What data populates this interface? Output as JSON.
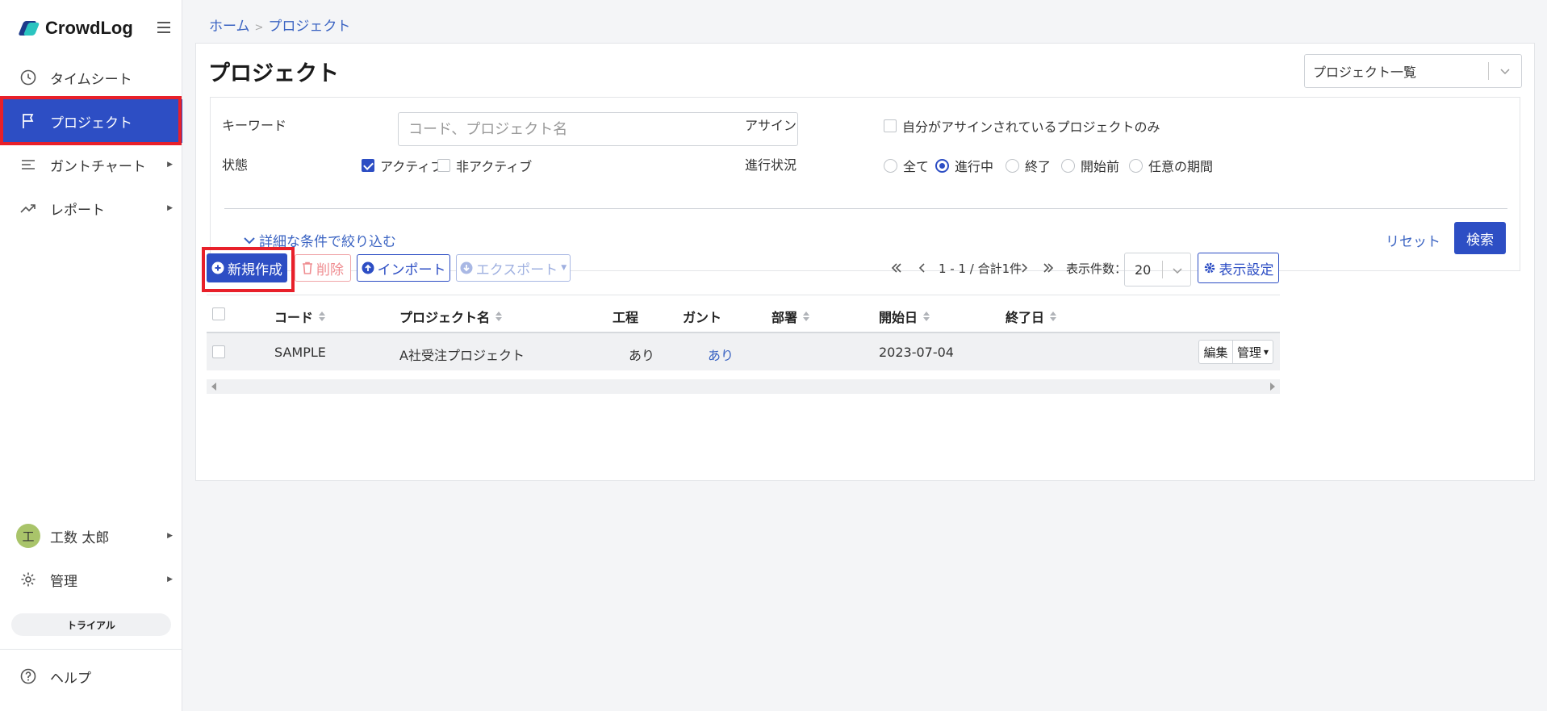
{
  "app": {
    "logo_text": "CrowdLog"
  },
  "sidebar": {
    "items": [
      {
        "label": "タイムシート",
        "icon": "clock-icon"
      },
      {
        "label": "プロジェクト",
        "icon": "flag-icon",
        "active": true
      },
      {
        "label": "ガントチャート",
        "icon": "gantt-icon",
        "has_submenu": true
      },
      {
        "label": "レポート",
        "icon": "trend-icon",
        "has_submenu": true
      }
    ],
    "user": {
      "avatar_initial": "工",
      "name": "工数 太郎"
    },
    "admin_label": "管理",
    "trial_label": "トライアル",
    "help_label": "ヘルプ"
  },
  "breadcrumb": {
    "home": "ホーム",
    "separator": ">",
    "current": "プロジェクト"
  },
  "page": {
    "title": "プロジェクト",
    "view_select": "プロジェクト一覧"
  },
  "filter": {
    "keyword_label": "キーワード",
    "keyword_placeholder": "コード、プロジェクト名",
    "keyword_value": "",
    "assign_label": "アサイン",
    "assign_option": "自分がアサインされているプロジェクトのみ",
    "assign_checked": false,
    "status_label": "状態",
    "status_options": [
      {
        "label": "アクティブ",
        "checked": true
      },
      {
        "label": "非アクティブ",
        "checked": false
      }
    ],
    "progress_label": "進行状況",
    "progress_options": [
      {
        "label": "全て",
        "selected": false
      },
      {
        "label": "進行中",
        "selected": true
      },
      {
        "label": "終了",
        "selected": false
      },
      {
        "label": "開始前",
        "selected": false
      },
      {
        "label": "任意の期間",
        "selected": false
      }
    ],
    "more_conditions": "詳細な条件で絞り込む",
    "reset_label": "リセット",
    "search_label": "検索"
  },
  "toolbar": {
    "new_label": "新規作成",
    "delete_label": "削除",
    "import_label": "インポート",
    "export_label": "エクスポート",
    "pagination_text": "1 - 1 / 合計1件",
    "per_page_label": "表示件数：",
    "per_page_value": "20",
    "display_settings_label": "表示設定"
  },
  "table": {
    "columns": [
      "コード",
      "プロジェクト名",
      "工程",
      "ガント",
      "部署",
      "開始日",
      "終了日"
    ],
    "rows": [
      {
        "code": "SAMPLE",
        "name": "A社受注プロジェクト",
        "process": "あり",
        "gantt": "あり",
        "department": "",
        "start_date": "2023-07-04",
        "end_date": ""
      }
    ],
    "row_actions": {
      "edit": "編集",
      "manage": "管理"
    }
  },
  "colors": {
    "primary": "#2d4ec4",
    "link": "#3a63c2",
    "highlight": "#e8202a",
    "avatar": "#a9c46a"
  }
}
